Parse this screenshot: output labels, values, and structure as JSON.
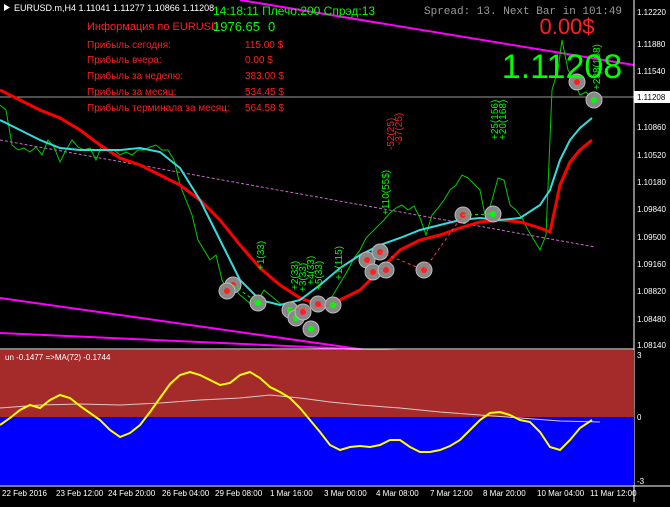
{
  "header": {
    "symbol_line": "EURUSD.m,H4  1.11041 1.11277 1.10866 1.11208",
    "status": "14:18:11 Плечо:200 Спрэд:13",
    "balance": "1976.65",
    "balance_suffix": "0",
    "spread_timer": "Spread: 13. Next Bar in 101:49",
    "profit_pct": "0.00$",
    "big_price": "1.11208"
  },
  "info_panel": {
    "title": "Информация по EURUSD",
    "rows": [
      {
        "label": "Прибыль сегодня:",
        "value": "115.00 $"
      },
      {
        "label": "Прибыль вчера:",
        "value": "0.00 $"
      },
      {
        "label": "Прибыль за неделю:",
        "value": "383.00 $"
      },
      {
        "label": "Прибыль за месяц:",
        "value": "534.45 $"
      },
      {
        "label": "Прибыль терминала за месяц:",
        "value": "564.58 $"
      }
    ]
  },
  "price_axis": [
    "1.12220",
    "1.11880",
    "1.11540",
    "1.11208",
    "1.10860",
    "1.10520",
    "1.10180",
    "1.09840",
    "1.09500",
    "1.09160",
    "1.08820",
    "1.08480",
    "1.08140"
  ],
  "time_axis": [
    "22 Feb 2016",
    "23 Feb 12:00",
    "24 Feb 20:00",
    "26 Feb 04:00",
    "29 Feb 08:00",
    "1 Mar 16:00",
    "3 Mar 00:00",
    "4 Mar 08:00",
    "7 Mar 12:00",
    "8 Mar 20:00",
    "10 Mar 04:00",
    "11 Mar 12:00"
  ],
  "indicator": {
    "label": "un -0.1477  =>MA(72) -0.1744",
    "axis_top": "3",
    "axis_mid": "0",
    "axis_bottom": "-3"
  },
  "trade_labels": [
    "+1(33)",
    "+2(33)",
    "+3(33)",
    "+4(33)",
    "+5(33)",
    "+1(115)",
    "+110(55$)",
    "+25(156)",
    "+20(168)",
    "+238(168)",
    "-52(25)",
    "-37(25)"
  ],
  "colors": {
    "background": "#000000",
    "price_line": "#00cc00",
    "ma_red": "#ff0000",
    "ma_cyan": "#33dddd",
    "channel": "#ff00ff",
    "trend_dotted": "#cc66cc",
    "info_red": "#ff2020",
    "status_green": "#00ff00",
    "indicator_top": "#a52a2a",
    "indicator_bottom": "#0000ff",
    "osc_yellow": "#ffff00"
  }
}
